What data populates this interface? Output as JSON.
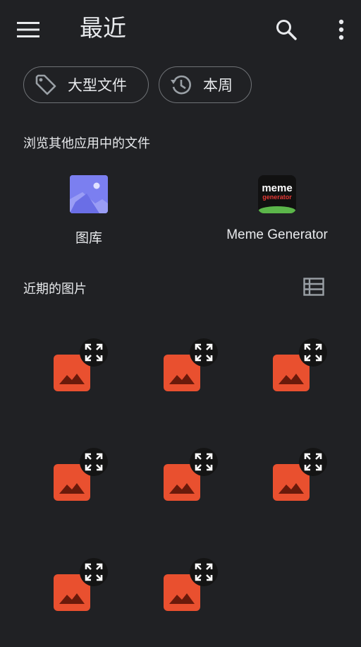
{
  "topbar": {
    "title": "最近",
    "menu_icon": "menu-icon",
    "search_icon": "search-icon",
    "more_icon": "more-vert-icon"
  },
  "chips": [
    {
      "label": "大型文件",
      "icon": "tag-icon"
    },
    {
      "label": "本周",
      "icon": "history-icon"
    }
  ],
  "browse": {
    "title": "浏览其他应用中的文件",
    "apps": [
      {
        "name": "图库",
        "icon": "gallery-icon"
      },
      {
        "name": "Meme Generator",
        "icon": "meme-generator-icon",
        "icon_text_1": "meme",
        "icon_text_2": "generator"
      }
    ]
  },
  "recent": {
    "title": "近期的图片",
    "view_toggle_icon": "list-view-icon",
    "images": [
      {
        "icon": "image-placeholder-icon"
      },
      {
        "icon": "image-placeholder-icon"
      },
      {
        "icon": "image-placeholder-icon"
      },
      {
        "icon": "image-placeholder-icon"
      },
      {
        "icon": "image-placeholder-icon"
      },
      {
        "icon": "image-placeholder-icon"
      },
      {
        "icon": "image-placeholder-icon"
      },
      {
        "icon": "image-placeholder-icon"
      }
    ]
  },
  "colors": {
    "background": "#202124",
    "text": "#e8eaed",
    "thumbnail_accent": "#e9502f",
    "gallery_icon": "#7b7ff0"
  }
}
